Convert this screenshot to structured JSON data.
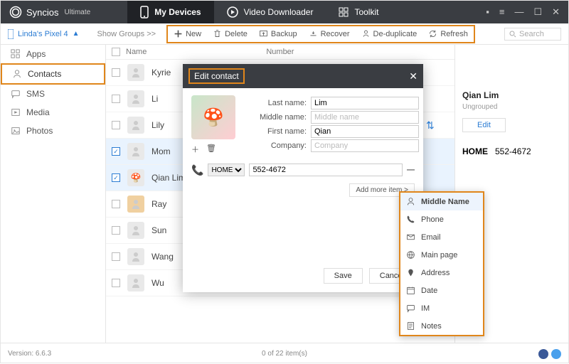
{
  "app": {
    "name": "Syncios",
    "edition": "Ultimate"
  },
  "tabs": {
    "devices": "My Devices",
    "downloader": "Video Downloader",
    "toolkit": "Toolkit"
  },
  "device": "Linda's Pixel 4",
  "showGroups": "Show Groups  >>",
  "tools": {
    "new": "New",
    "delete": "Delete",
    "backup": "Backup",
    "recover": "Recover",
    "dedup": "De-duplicate",
    "refresh": "Refresh"
  },
  "search": {
    "placeholder": "Search"
  },
  "nav": {
    "apps": "Apps",
    "contacts": "Contacts",
    "sms": "SMS",
    "media": "Media",
    "photos": "Photos"
  },
  "listHeader": {
    "name": "Name",
    "number": "Number"
  },
  "contacts": [
    "Kyrie",
    "Li",
    "Lily",
    "Mom",
    "Qian Lim",
    "Ray",
    "Sun",
    "Wang",
    "Wu"
  ],
  "selectedIdx": [
    3,
    4
  ],
  "detail": {
    "name": "Qian Lim",
    "group": "Ungrouped",
    "editBtn": "Edit",
    "phoneType": "HOME",
    "phone": "552-4672"
  },
  "modal": {
    "title": "Edit contact",
    "labels": {
      "last": "Last name:",
      "middle": "Middle name:",
      "first": "First name:",
      "company": "Company:"
    },
    "values": {
      "last": "Lim",
      "middle": "",
      "first": "Qian",
      "company": ""
    },
    "placeholders": {
      "middle": "Middle name",
      "company": "Company"
    },
    "phoneType": "HOME",
    "phone": "552-4672",
    "addMore": "Add more item >",
    "save": "Save",
    "cancel": "Cancel"
  },
  "addMenu": [
    "Middle Name",
    "Phone",
    "Email",
    "Main page",
    "Address",
    "Date",
    "IM",
    "Notes"
  ],
  "addMenuIcons": [
    "user-icon",
    "phone-icon",
    "mail-icon",
    "globe-icon",
    "pin-icon",
    "calendar-icon",
    "chat-icon",
    "note-icon"
  ],
  "status": {
    "version": "Version: 6.6.3",
    "count": "0 of 22 item(s)"
  }
}
